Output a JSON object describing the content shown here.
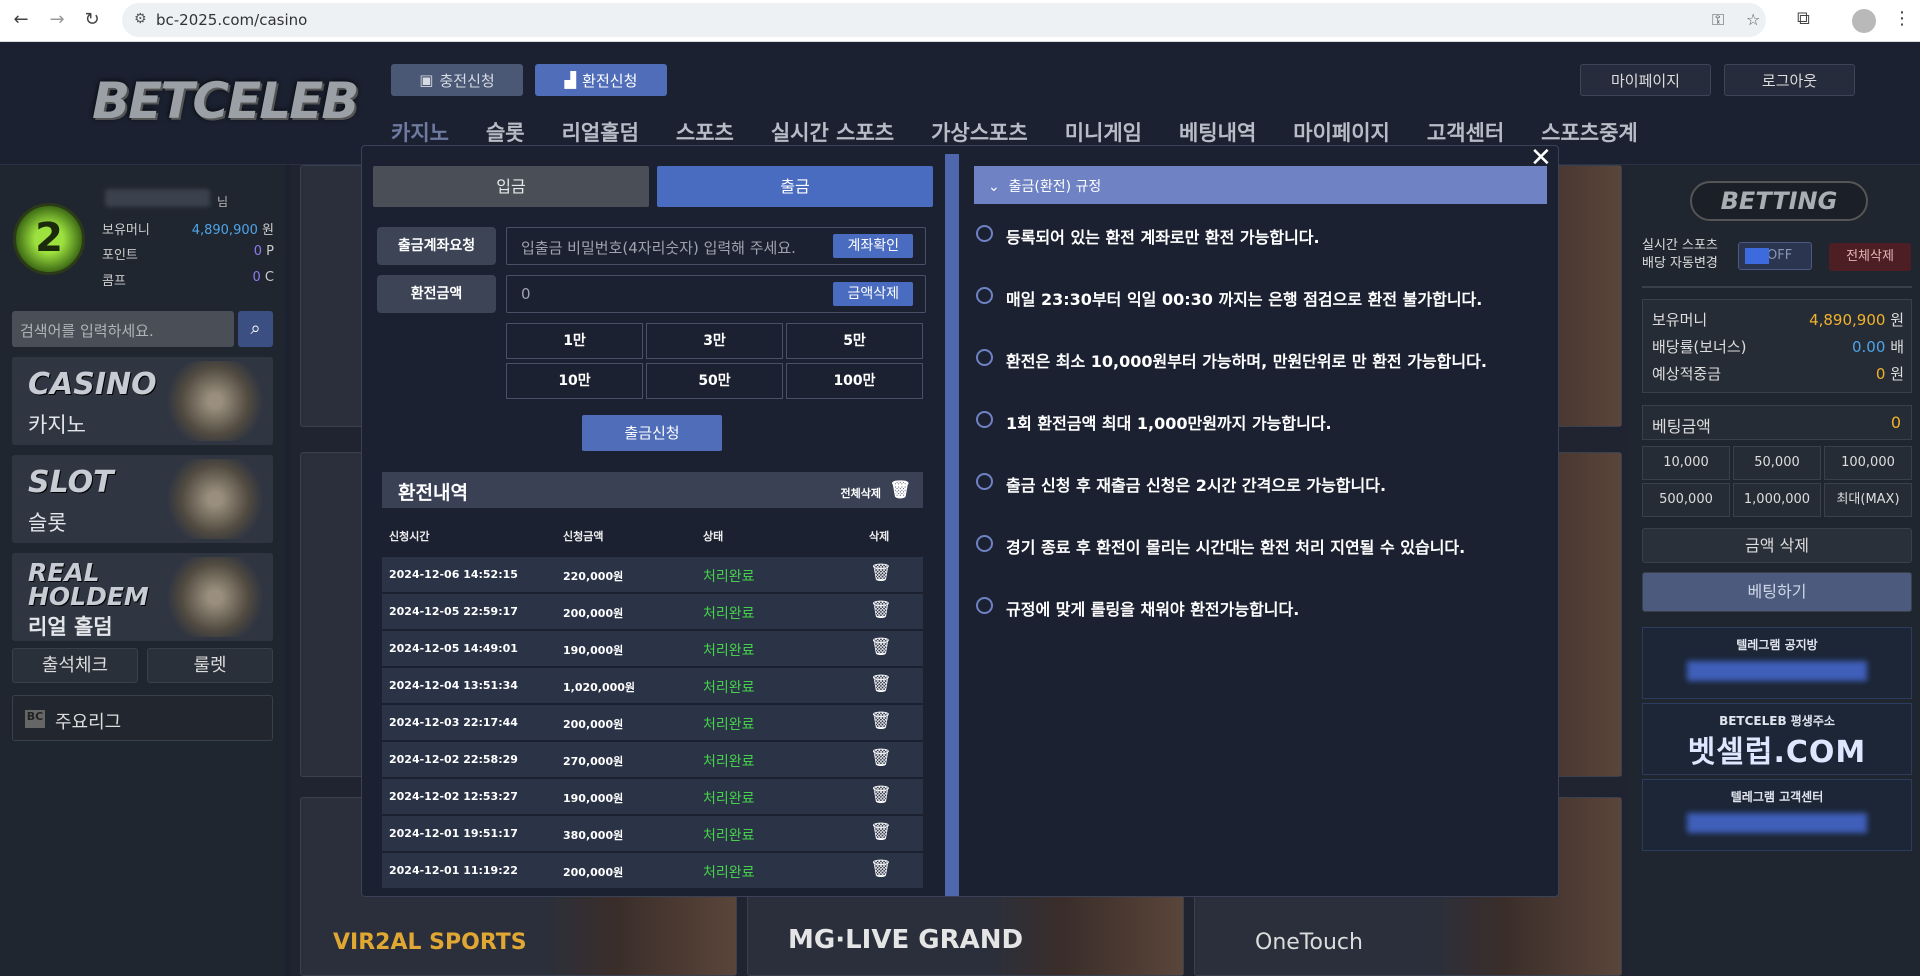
{
  "browser": {
    "url": "bc-2025.com/casino"
  },
  "header": {
    "logo": "BETCELEB",
    "deposit_btn": "충전신청",
    "withdraw_btn": "환전신청",
    "mypage_btn": "마이페이지",
    "logout_btn": "로그아웃",
    "nav": [
      "카지노",
      "슬롯",
      "리얼홀덤",
      "스포츠",
      "실시간 스포츠",
      "가상스포츠",
      "미니게임",
      "베팅내역",
      "마이페이지",
      "고객센터",
      "스포츠중계"
    ]
  },
  "left": {
    "level": "2",
    "name_suffix": "님",
    "stats": [
      {
        "label": "보유머니",
        "value": "4,890,900",
        "unit": "원"
      },
      {
        "label": "포인트",
        "value": "0",
        "unit": "P"
      },
      {
        "label": "콤프",
        "value": "0",
        "unit": "C"
      }
    ],
    "search_placeholder": "검색어를 입력하세요.",
    "tiles": [
      {
        "en": "CASINO",
        "ko": "카지노"
      },
      {
        "en": "SLOT",
        "ko": "슬롯"
      },
      {
        "en": "REAL HOLDEM",
        "ko": "리얼 홀덤"
      }
    ],
    "attend_btn": "출석체크",
    "roulette_btn": "룰렛",
    "league_btn": "주요리그"
  },
  "providers": [
    "VIR2AL SPORTS",
    "MG·LIVE GRAND",
    "OneTouch"
  ],
  "right": {
    "betting_logo": "BETTING",
    "auto_label": "실시간 스포츠\n배당 자동변경",
    "toggle_on": "ON",
    "toggle_off": "OFF",
    "delete_all": "전체삭제",
    "info": [
      {
        "label": "보유머니",
        "value": "4,890,900",
        "unit": "원"
      },
      {
        "label": "배당률(보너스)",
        "value": "0.00",
        "unit": "배"
      },
      {
        "label": "예상적중금",
        "value": "0",
        "unit": "원"
      }
    ],
    "bet_amount_label": "베팅금액",
    "bet_amount_value": "0",
    "chips": [
      "10,000",
      "50,000",
      "100,000",
      "500,000",
      "1,000,000",
      "최대(MAX)"
    ],
    "clear_btn": "금액 삭제",
    "bet_btn": "베팅하기",
    "banner1": "텔레그램 공지방",
    "banner2_title": "BETCELEB 평생주소",
    "banner2_big": "벳셀럽.COM",
    "banner3": "텔레그램 고객센터"
  },
  "modal": {
    "tab_in": "입금",
    "tab_out": "출금",
    "account_label": "출금계좌요청",
    "account_placeholder": "입출금 비밀번호(4자리숫자) 입력해 주세요.",
    "account_btn": "계좌확인",
    "amount_label": "환전금액",
    "amount_value": "0",
    "amount_clear_btn": "금액삭제",
    "amounts": [
      "1만",
      "3만",
      "5만",
      "10만",
      "50만",
      "100만"
    ],
    "apply_btn": "출금신청",
    "history_title": "환전내역",
    "history_delete_all": "전체삭제",
    "columns": [
      "신청시간",
      "신청금액",
      "상태",
      "삭제"
    ],
    "history": [
      {
        "time": "2024-12-06 14:52:15",
        "amount": "220,000원",
        "status": "처리완료"
      },
      {
        "time": "2024-12-05 22:59:17",
        "amount": "200,000원",
        "status": "처리완료"
      },
      {
        "time": "2024-12-05 14:49:01",
        "amount": "190,000원",
        "status": "처리완료"
      },
      {
        "time": "2024-12-04 13:51:34",
        "amount": "1,020,000원",
        "status": "처리완료"
      },
      {
        "time": "2024-12-03 22:17:44",
        "amount": "200,000원",
        "status": "처리완료"
      },
      {
        "time": "2024-12-02 22:58:29",
        "amount": "270,000원",
        "status": "처리완료"
      },
      {
        "time": "2024-12-02 12:53:27",
        "amount": "190,000원",
        "status": "처리완료"
      },
      {
        "time": "2024-12-01 19:51:17",
        "amount": "380,000원",
        "status": "처리완료"
      },
      {
        "time": "2024-12-01 11:19:22",
        "amount": "200,000원",
        "status": "처리완료"
      }
    ],
    "rules_title": "출금(환전) 규정",
    "rules": [
      "등록되어 있는 환전 계좌로만 환전 가능합니다.",
      "매일 23:30부터 익일 00:30 까지는 은행 점검으로 환전 불가합니다.",
      "환전은 최소 10,000원부터 가능하며, 만원단위로 만 환전 가능합니다.",
      "1회 환전금액 최대 1,000만원까지 가능합니다.",
      "출금 신청 후 재출금 신청은 2시간 간격으로 가능합니다.",
      "경기 종료 후 환전이 몰리는 시간대는 환전 처리 지연될 수 있습니다.",
      "규정에 맞게 롤링을 채워야 환전가능합니다."
    ]
  }
}
